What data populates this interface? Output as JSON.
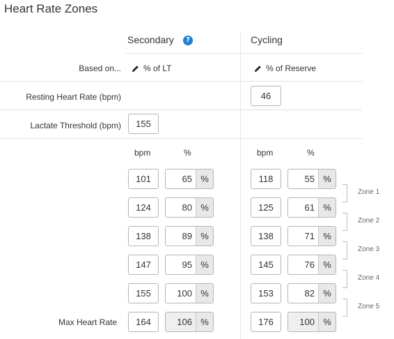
{
  "page": {
    "title": "Heart Rate Zones"
  },
  "columns": {
    "secondary": {
      "label": "Secondary",
      "help_icon": "question-circle-icon"
    },
    "cycling": {
      "label": "Cycling"
    }
  },
  "settings": {
    "based_on_label": "Based on...",
    "secondary_based_on": "% of LT",
    "cycling_based_on": "% of Reserve",
    "resting_label": "Resting Heart Rate (bpm)",
    "cycling_resting_value": "46",
    "lactate_label": "Lactate Threshold (bpm)",
    "secondary_lactate_value": "155"
  },
  "zone_headers": {
    "secondary_bpm": "bpm",
    "secondary_pct": "%",
    "cycling_bpm": "bpm",
    "cycling_pct": "%"
  },
  "percent_sign": "%",
  "zones": [
    {
      "secondary_bpm": "101",
      "secondary_pct": "65",
      "cycling_bpm": "118",
      "cycling_pct": "55"
    },
    {
      "secondary_bpm": "124",
      "secondary_pct": "80",
      "cycling_bpm": "125",
      "cycling_pct": "61"
    },
    {
      "secondary_bpm": "138",
      "secondary_pct": "89",
      "cycling_bpm": "138",
      "cycling_pct": "71"
    },
    {
      "secondary_bpm": "147",
      "secondary_pct": "95",
      "cycling_bpm": "145",
      "cycling_pct": "76"
    },
    {
      "secondary_bpm": "155",
      "secondary_pct": "100",
      "cycling_bpm": "153",
      "cycling_pct": "82"
    }
  ],
  "max_heart_rate": {
    "label": "Max Heart Rate",
    "secondary_bpm": "164",
    "secondary_pct": "106",
    "cycling_bpm": "176",
    "cycling_pct": "100"
  },
  "zone_labels": [
    "Zone 1",
    "Zone 2",
    "Zone 3",
    "Zone 4",
    "Zone 5"
  ],
  "colors": {
    "help_icon": "#1f7fd1",
    "divider": "#e3e3e3",
    "readonly_fill": "#efefef"
  }
}
